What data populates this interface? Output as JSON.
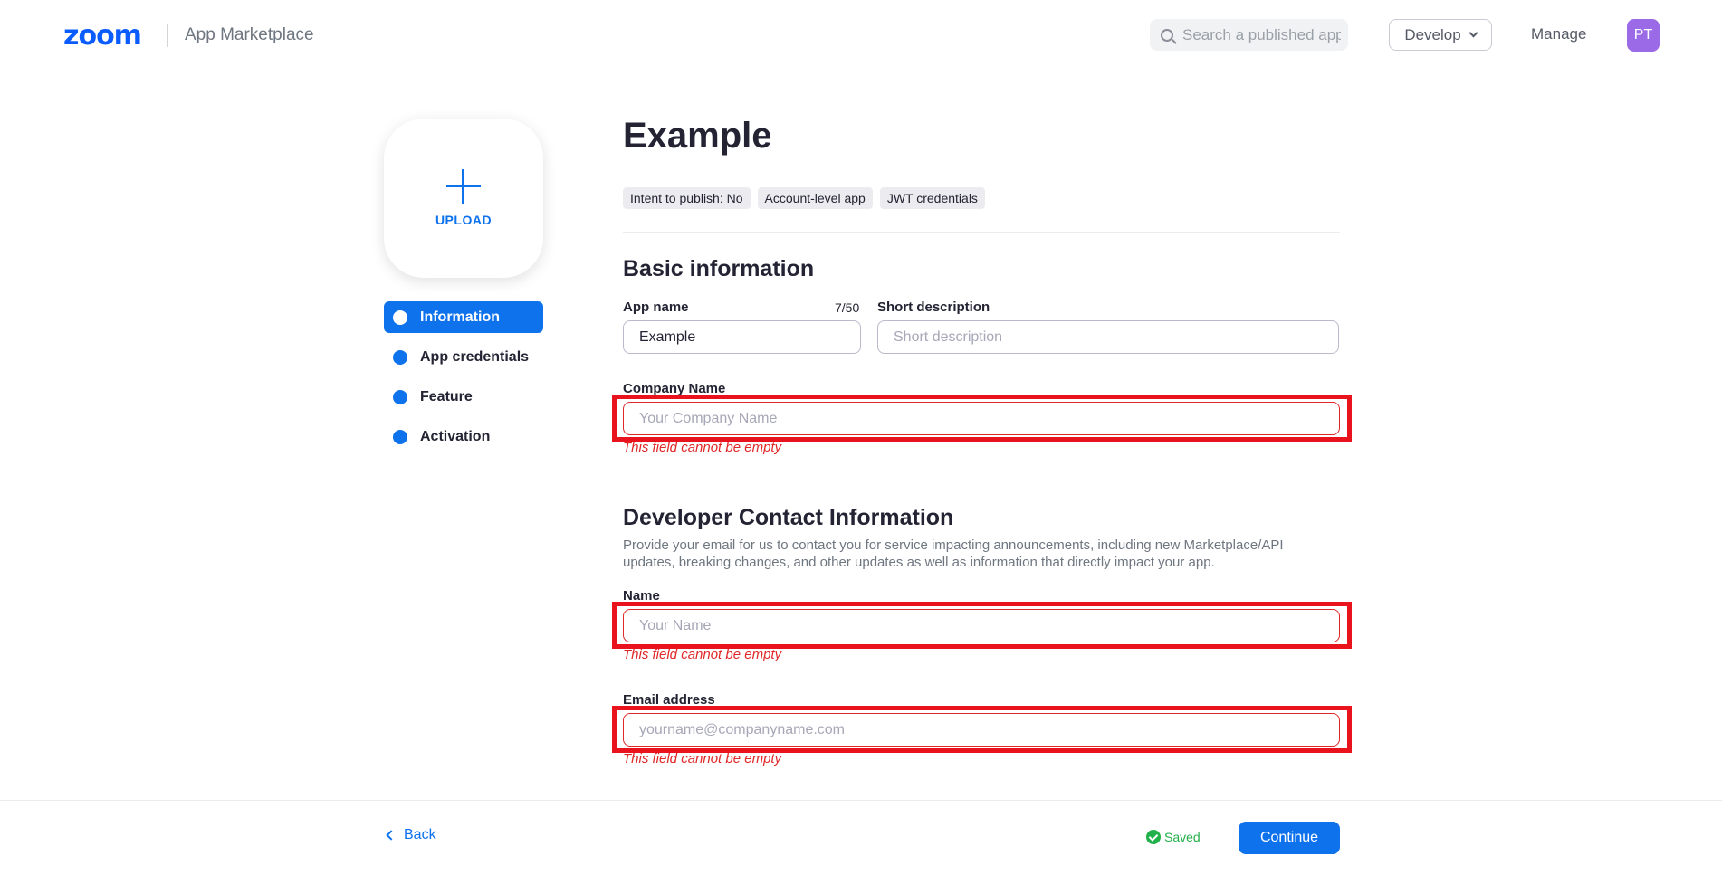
{
  "header": {
    "logo": "zoom",
    "app_title": "App Marketplace",
    "search_placeholder": "Search a published app",
    "develop_label": "Develop",
    "manage_label": "Manage",
    "avatar_initials": "PT"
  },
  "sidebar": {
    "upload_label": "UPLOAD",
    "items": [
      {
        "label": "Information",
        "active": true
      },
      {
        "label": "App credentials",
        "active": false
      },
      {
        "label": "Feature",
        "active": false
      },
      {
        "label": "Activation",
        "active": false
      }
    ]
  },
  "main": {
    "title": "Example",
    "tags": [
      "Intent to publish: No",
      "Account-level app",
      "JWT credentials"
    ],
    "basic_info": {
      "heading": "Basic information",
      "app_name_label": "App name",
      "app_name_counter": "7/50",
      "app_name_value": "Example",
      "short_desc_label": "Short description",
      "short_desc_placeholder": "Short description",
      "company_name_label": "Company Name",
      "company_name_placeholder": "Your Company Name",
      "company_name_error": "This field cannot be empty"
    },
    "developer_contact": {
      "heading": "Developer Contact Information",
      "description": "Provide your email for us to contact you for service impacting announcements, including new Marketplace/API updates, breaking changes, and other updates as well as information that directly impact your app.",
      "name_label": "Name",
      "name_placeholder": "Your Name",
      "name_error": "This field cannot be empty",
      "email_label": "Email address",
      "email_placeholder": "yourname@companyname.com",
      "email_error": "This field cannot be empty"
    }
  },
  "footer": {
    "back_label": "Back",
    "saved_label": "Saved",
    "continue_label": "Continue"
  },
  "colors": {
    "brand": "#0b5cff",
    "primary": "#0e72ed",
    "error": "#e02828",
    "highlight_frame": "#e8131c",
    "saved": "#22b04b",
    "avatar": "#9b6ae6"
  }
}
